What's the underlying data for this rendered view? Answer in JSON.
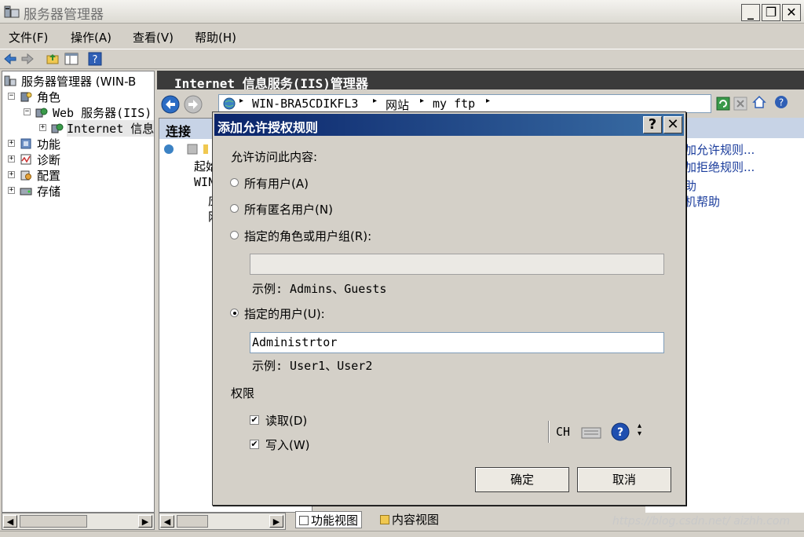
{
  "window": {
    "title": "服务器管理器",
    "minimize": "_",
    "restore": "❐",
    "close": "✕"
  },
  "menu": [
    "文件(F)",
    "操作(A)",
    "查看(V)",
    "帮助(H)"
  ],
  "tree": [
    {
      "label": "服务器管理器 (WIN-B",
      "toggle": ""
    },
    {
      "label": "角色",
      "toggle": "−"
    },
    {
      "label": "Web 服务器(IIS)",
      "toggle": "−"
    },
    {
      "label": "Internet 信息",
      "toggle": "+"
    },
    {
      "label": "功能",
      "toggle": "+"
    },
    {
      "label": "诊断",
      "toggle": "+"
    },
    {
      "label": "配置",
      "toggle": "+"
    },
    {
      "label": "存储",
      "toggle": "+"
    }
  ],
  "iis": {
    "title": "Internet 信息服务(IIS)管理器",
    "breadcrumb": [
      "WIN-BRA5CDIKFL3",
      "网站",
      "my ftp"
    ],
    "sep": "▸",
    "connections_title": "连接",
    "conn_items": [
      "起始",
      "WIN",
      "应",
      "网",
      "",
      ""
    ],
    "actions": [
      "加允许规则...",
      "加拒绝规则...",
      "助",
      "机帮助"
    ],
    "views": [
      "功能视图",
      "内容视图"
    ]
  },
  "dialog": {
    "title": "添加允许授权规则",
    "help": "?",
    "close": "✕",
    "prompt": "允许访问此内容:",
    "options": [
      {
        "label": "所有用户(A)",
        "selected": false
      },
      {
        "label": "所有匿名用户(N)",
        "selected": false
      },
      {
        "label": "指定的角色或用户组(R):",
        "selected": false
      },
      {
        "label": "指定的用户(U):",
        "selected": true
      }
    ],
    "roles_value": "",
    "roles_example": "示例: Admins、Guests",
    "users_value": "Administrtor",
    "users_example": "示例: User1、User2",
    "permissions_label": "权限",
    "permissions": [
      {
        "label": "读取(D)",
        "checked": true
      },
      {
        "label": "写入(W)",
        "checked": true
      }
    ],
    "ok": "确定",
    "cancel": "取消"
  },
  "ime": {
    "lang": "CH",
    "help": "?"
  },
  "watermark": "https://blog.csdn.net/  aizhh.com"
}
